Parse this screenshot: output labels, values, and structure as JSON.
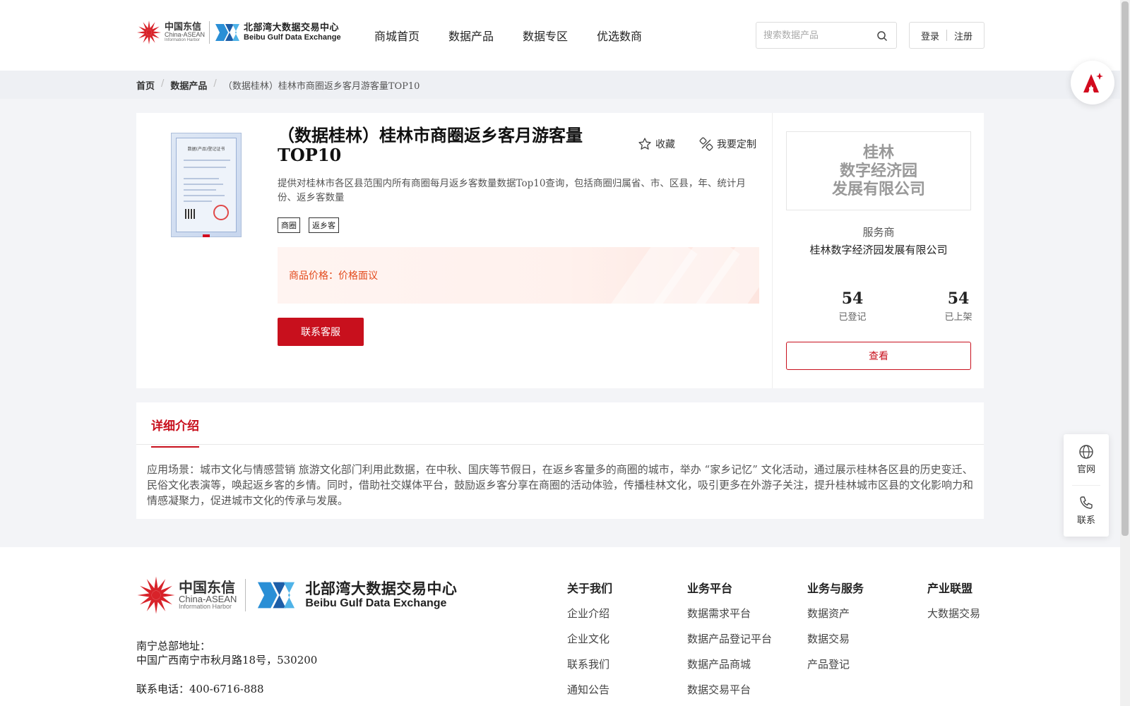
{
  "header": {
    "logo": {
      "cn_name": "中国东信",
      "en_name": "China-ASEAN",
      "en_sub": "Information Harbor",
      "exchange_cn": "北部湾大数据交易中心",
      "exchange_en": "Beibu Gulf Data Exchange"
    },
    "nav": [
      "商城首页",
      "数据产品",
      "数据专区",
      "优选数商"
    ],
    "search": {
      "placeholder": "搜索数据产品",
      "value": ""
    },
    "login": "登录",
    "register": "注册"
  },
  "breadcrumb": {
    "home": "首页",
    "category": "数据产品",
    "current": "（数据桂林）桂林市商圈返乡客月游客量TOP10"
  },
  "product": {
    "thumbnail_title": "数据(产品)登记证书",
    "title": "（数据桂林）桂林市商圈返乡客月游客量TOP10",
    "favorite": "收藏",
    "customize": "我要定制",
    "description": "提供对桂林市各区县范围内所有商圈每月返乡客数量数据Top10查询，包括商圈归属省、市、区县，年、统计月份、返乡客数量",
    "tags": [
      "商圈",
      "返乡客"
    ],
    "price_label": "商品价格：",
    "price_value": "价格面议",
    "contact_button": "联系客服"
  },
  "provider": {
    "logo_lines": [
      "桂林",
      "数字经济园",
      "发展有限公司"
    ],
    "role": "服务商",
    "name": "桂林数字经济园发展有限公司",
    "registered": {
      "value": "54",
      "label": "已登记"
    },
    "listed": {
      "value": "54",
      "label": "已上架"
    },
    "view_button": "查看"
  },
  "detail": {
    "tab": "详细介绍",
    "text": "应用场景：城市文化与情感营销 旅游文化部门利用此数据，在中秋、国庆等节假日，在返乡客量多的商圈的城市，举办 “家乡记忆” 文化活动，通过展示桂林各区县的历史变迁、民俗文化表演等，唤起返乡客的乡情。同时，借助社交媒体平台，鼓励返乡客分享在商圈的活动体验，传播桂林文化，吸引更多在外游子关注，提升桂林城市区县的文化影响力和情感凝聚力，促进城市文化的传承与发展。"
  },
  "footer": {
    "address_label": "南宁总部地址：",
    "address": "中国广西南宁市秋月路18号，530200",
    "phone": "联系电话：400-6716-888",
    "columns": [
      {
        "title": "关于我们",
        "items": [
          "企业介绍",
          "企业文化",
          "联系我们",
          "通知公告"
        ]
      },
      {
        "title": "业务平台",
        "items": [
          "数据需求平台",
          "数据产品登记平台",
          "数据产品商城",
          "数据交易平台"
        ]
      },
      {
        "title": "业务与服务",
        "items": [
          "数据资产",
          "数据交易",
          "产品登记"
        ]
      },
      {
        "title": "产业联盟",
        "items": [
          "大数据交易"
        ]
      }
    ]
  },
  "side_float": {
    "official": "官网",
    "contact": "联系"
  },
  "colors": {
    "brand_red": "#c8101d",
    "price_orange": "#e34a1b"
  },
  "icons": [
    "search-icon",
    "star-icon",
    "customize-icon",
    "globe-icon",
    "phone-icon",
    "ai-assistant-icon"
  ]
}
